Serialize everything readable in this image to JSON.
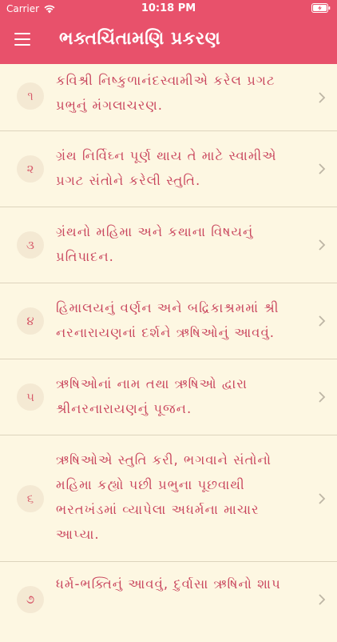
{
  "status": {
    "carrier": "Carrier",
    "time": "10:18 PM"
  },
  "header": {
    "title": "ભક્તચિંતામણિ પ્રકરણ",
    "color": "#e8516b"
  },
  "chapters": [
    {
      "number": "૧",
      "title": "કવિશ્રી નિષ્કુળાનંદસ્વામીએ કરેલ પ્રગટ પ્રભુનું મંગલાચરણ."
    },
    {
      "number": "૨",
      "title": "ગ્રંથ નિર્વિઘ્ન પૂર્ણ થાય તે માટે સ્વામીએ પ્રગટ સંતોને કરેલી સ્તુતિ."
    },
    {
      "number": "૩",
      "title": "ગ્રંથનો મહિમા અને કથાના વિષયનું પ્રતિપાદન."
    },
    {
      "number": "૪",
      "title": "હિમાલયનું વર્ણન અને બદ્રિકાશ્રમમાં શ્રી નરનારાયણનાં દર્શને ઋષિઓનું આવવું."
    },
    {
      "number": "૫",
      "title": "ઋષિઓનાં નામ તથા ઋષિઓ દ્વારા શ્રીનરનારાયણનું પૂજન."
    },
    {
      "number": "૬",
      "title": "ઋષિઓએ સ્તુતિ કરી, ભગવાને સંતોનો મહિમા કહ્યો પછી પ્રભુના પૂછવાથી ભરતખંડમાં વ્યાપેલા અધર્મના માચાર આપ્યા."
    },
    {
      "number": "૭",
      "title": "ધર્મ-ભક્તિનું આવવું, દુર્વાસા ઋષિનો શાપ"
    }
  ]
}
